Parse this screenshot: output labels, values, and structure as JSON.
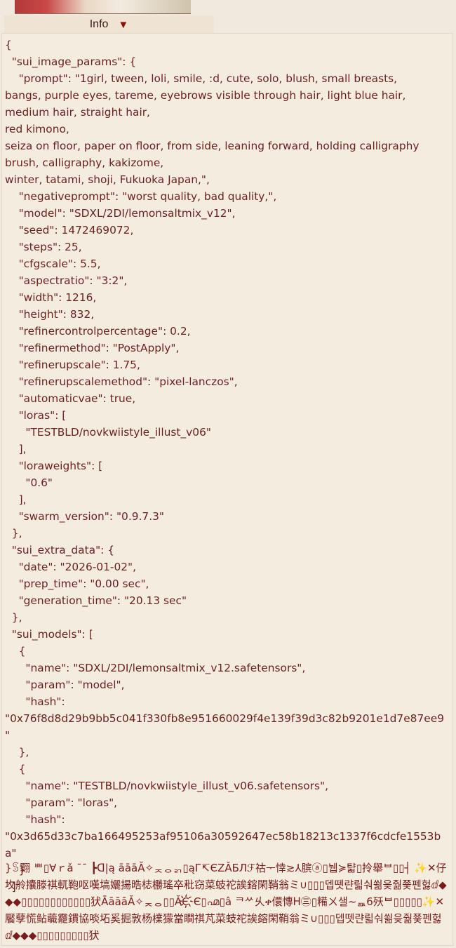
{
  "info_tab": {
    "label": "Info",
    "arrow_icon": "triangle-down-icon"
  },
  "metadata_text": "{\n  \"sui_image_params\": {\n    \"prompt\": \"1girl, tween, loli, smile, :d, cute, solo, blush, small breasts,\nbangs, purple eyes, tareme, eyebrows visible through hair, light blue hair, medium hair, straight hair,\nred kimono,\nseiza on floor, paper on floor, from side, leaning forward, holding calligraphy brush, calligraphy, kakizome,\nwinter, tatami, shoji, Fukuoka Japan,\",\n    \"negativeprompt\": \"worst quality, bad quality,\",\n    \"model\": \"SDXL/2DI/lemonsaltmix_v12\",\n    \"seed\": 1472469072,\n    \"steps\": 25,\n    \"cfgscale\": 5.5,\n    \"aspectratio\": \"3:2\",\n    \"width\": 1216,\n    \"height\": 832,\n    \"refinercontrolpercentage\": 0.2,\n    \"refinermethod\": \"PostApply\",\n    \"refinerupscale\": 1.75,\n    \"refinerupscalemethod\": \"pixel-lanczos\",\n    \"automaticvae\": true,\n    \"loras\": [\n      \"TESTBLD/novkwiistyle_illust_v06\"\n    ],\n    \"loraweights\": [\n      \"0.6\"\n    ],\n    \"swarm_version\": \"0.9.7.3\"\n  },\n  \"sui_extra_data\": {\n    \"date\": \"2026-01-02\",\n    \"prep_time\": \"0.00 sec\",\n    \"generation_time\": \"20.13 sec\"\n  },\n  \"sui_models\": [\n    {\n      \"name\": \"SDXL/2DI/lemonsaltmix_v12.safetensors\",\n      \"param\": \"model\",\n      \"hash\":\n\"0x76f8d8d29b9bb5c041f330fb8e951660029f4e139f39d3c82b9201e1d7e87ee9\"\n    },\n    {\n      \"name\": \"TESTBLD/novkwiistyle_illust_v06.safetensors\",\n      \"param\": \"loras\",\n      \"hash\":\n\"0x3d65d33c7ba166495253af95106a30592647ec58b18213c1337f6cdcfe1553ba\"\n    }\n  ]",
  "garbled_text": "}ꌗ翾 ᄈ▯∀ｒǎ ¯¯ ┣ᗡ|ą āāāĂ✧ᆽᆼᆰ▯ąГ↸ЄΖǍБЛℱ祜ᅮ悻≳⅄膑ⓐ▯뉍≽턃▯拎舉ᄇ▯▯┤ ✨✕仔坆舲攮滕褀軏鞄呕嘆塙孋揚晧梽橳瑤卒秕窃菜蚑袉誒鎔閑鞘翁ミ∪▯▯▯뎁뗏랸릷숴쐶읒줢쭃펜헗ⅆ◆◆◆▯▯▯▯▯▯▯▯▯▯▯▯犾ĀāāāĂ✧ᆽᆼ▯▯ĂЄ҉Є▯൶▯â ᄏᄽ乆ቀ儇慱ᕼ㊂▯糒ㄨ샐~ᇒ6殀ᄇ▯▯▯▯▯✨✕饜孽慌鲇蘵龗鏆協啖坧奚掘敦杨檏獴當瞷祺芃菜蚑袉誒鎔閑鞘翁ミ∪▯▯▯뎁뗏랸릷숴쐶읒줢쭃펜헗ⅆ◆◆◆▯▯▯▯▯▯▯▯▯犾"
}
